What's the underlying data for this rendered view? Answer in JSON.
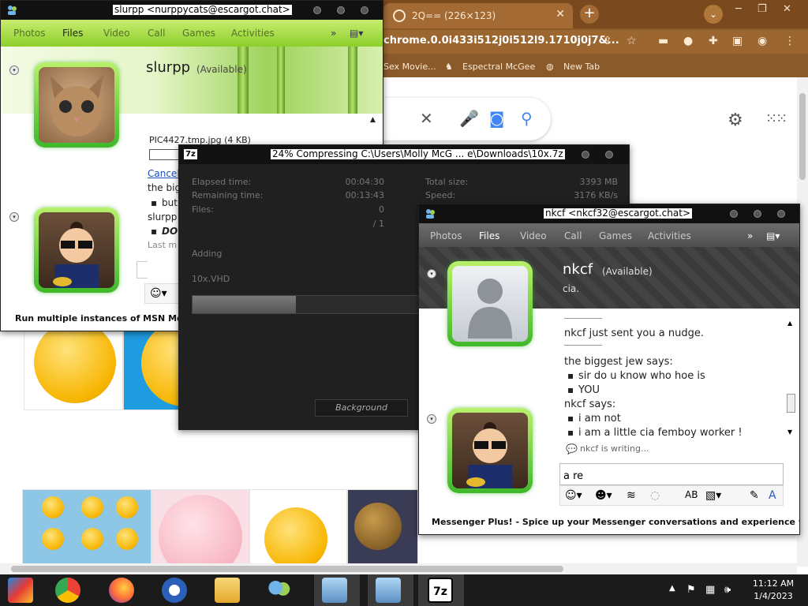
{
  "browser": {
    "tab_title": "2Q== (226×123)",
    "tab_close": "✕",
    "new_tab": "+",
    "tab_menu": "⌄",
    "url": "chrome.0.0i433i512j0i512l9.1710j0j7&...",
    "bookmarks": [
      "Sex Movie...",
      "Espectral McGee",
      "New Tab"
    ],
    "win_controls": [
      "─",
      "❐",
      "✕"
    ]
  },
  "msn1": {
    "title": "slurpp <nurppycats@escargot.chat>",
    "menu": [
      "Photos",
      "Files",
      "Video",
      "Call",
      "Games",
      "Activities"
    ],
    "contact_name": "slurpp",
    "contact_status": "(Available)",
    "file_name": "PIC4427.tmp.jpg (4 KB)",
    "cancel": "Cancel",
    "lines": [
      "the big",
      "but",
      "slurpp",
      "DO",
      "Last m"
    ],
    "footer": "Run multiple instances of MSN Messenger"
  },
  "sevenzip": {
    "icon_text": "7z",
    "title": "24% Compressing C:\\Users\\Molly McG ... e\\Downloads\\10x.7z",
    "elapsed_label": "Elapsed time:",
    "elapsed": "00:04:30",
    "remaining_label": "Remaining time:",
    "remaining": "00:13:43",
    "files_label": "Files:",
    "files": "0",
    "files_total": "/ 1",
    "total_size_label": "Total size:",
    "total_size": "3393 MB",
    "speed_label": "Speed:",
    "speed": "3176 KB/s",
    "adding": "Adding",
    "current_file": "10x.VHD",
    "progress": 0.24,
    "background_button": "Background"
  },
  "msn2": {
    "title": "nkcf <nkcf32@escargot.chat>",
    "menu": [
      "Photos",
      "Files",
      "Video",
      "Call",
      "Games",
      "Activities"
    ],
    "contact_name": "nkcf",
    "contact_status": "(Available)",
    "contact_message": "cia.",
    "nudge": "nkcf just sent you a nudge.",
    "msg_header_1": "the biggest jew says:",
    "msg_1a": "sir do u know who hoe is",
    "msg_1b": "YOU",
    "msg_header_2": "nkcf says:",
    "msg_2a": "i am not",
    "msg_2b": "i am a little cia femboy worker !",
    "typing": "nkcf is writing...",
    "input_value": "a re",
    "footer": "Messenger Plus! - Spice up your Messenger conversations and experience w..."
  },
  "taskbar": {
    "time": "11:12 AM",
    "date": "1/4/2023"
  }
}
